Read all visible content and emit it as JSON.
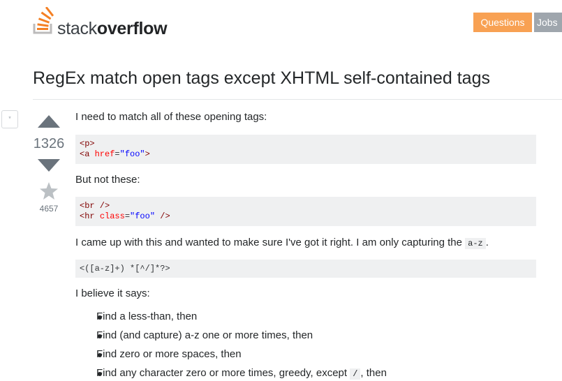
{
  "header": {
    "logo_light": "stack",
    "logo_bold": "overflow",
    "nav": {
      "questions": "Questions",
      "jobs": "Jobs"
    }
  },
  "question": {
    "title": "RegEx match open tags except XHTML self-contained tags",
    "side_button": "*",
    "votes": "1326",
    "favorites": "4657",
    "body": {
      "p1": "I need to match all of these opening tags:",
      "code1": [
        {
          "tag_open": "<p>"
        },
        {
          "tag_open": "<a ",
          "attr": "href",
          "eq": "=",
          "str": "\"foo\"",
          "tag_close": ">"
        }
      ],
      "p2": "But not these:",
      "code2": [
        {
          "tag_open": "<br />"
        },
        {
          "tag_open": "<hr ",
          "attr": "class",
          "eq": "=",
          "str": "\"foo\"",
          "tag_close": " />"
        }
      ],
      "p3_text": "I came up with this and wanted to make sure I've got it right. I am only capturing the",
      "p3_code": "a-z",
      "p3_end": ".",
      "code3": "<([a-z]+) *[^/]*?>",
      "p4": "I believe it says:",
      "bullets": [
        {
          "text": "Find a less-than, then"
        },
        {
          "text": "Find (and capture) a-z one or more times, then"
        },
        {
          "text": "Find zero or more spaces, then"
        },
        {
          "text": "Find any character zero or more times, greedy, except",
          "code": "/",
          "end": ", then"
        }
      ]
    }
  },
  "colors": {
    "questions_button": "#f8a153",
    "jobs_button": "#9fa6ad",
    "code_bg": "#eff0f1",
    "vote_arrow": "#6a737c",
    "star": "#bbc0c4"
  }
}
